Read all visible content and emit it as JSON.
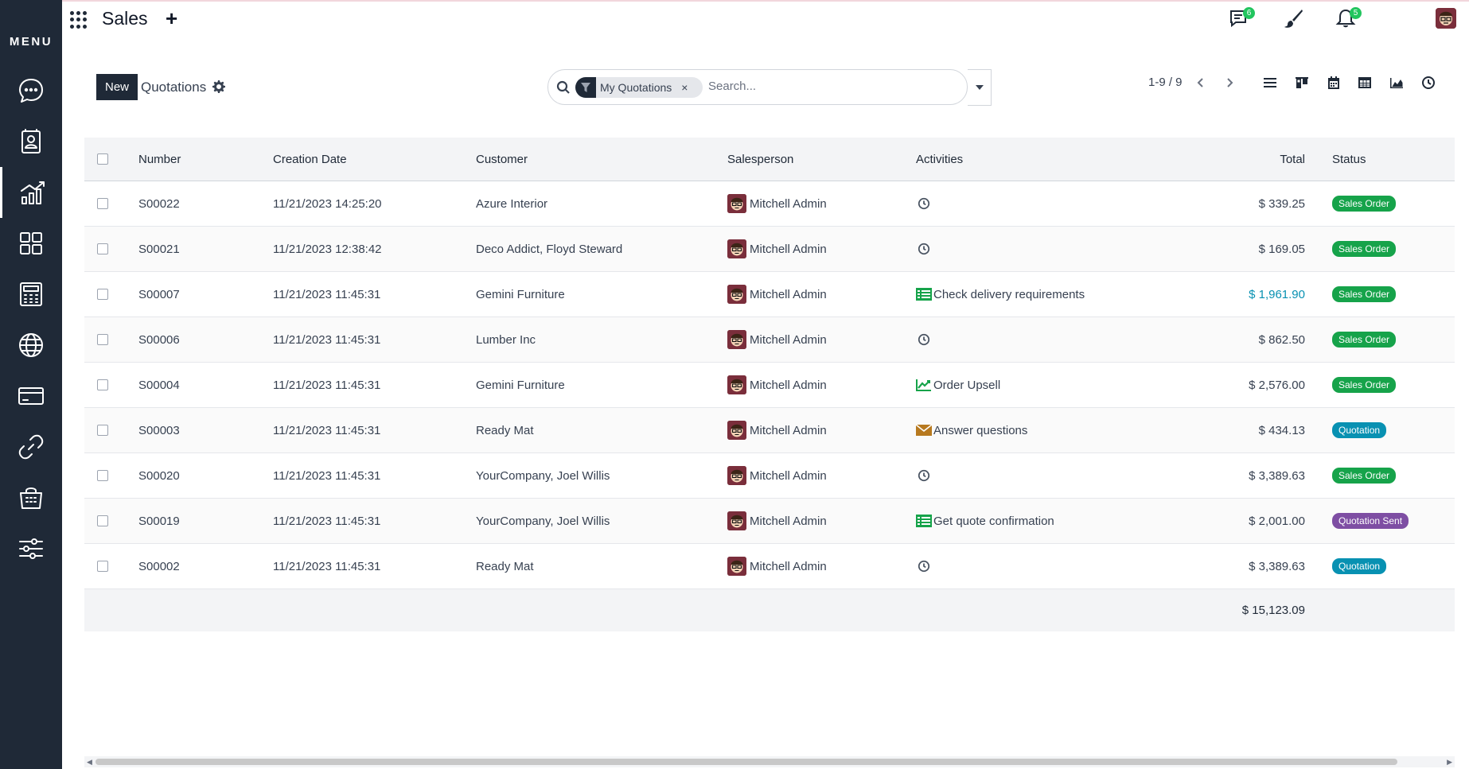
{
  "sidebar": {
    "menu_label": "MENU",
    "items": [
      {
        "icon": "discuss-icon"
      },
      {
        "icon": "contacts-icon"
      },
      {
        "icon": "sales-chart-icon",
        "active": true
      },
      {
        "icon": "dashboard-icon"
      },
      {
        "icon": "calculator-icon"
      },
      {
        "icon": "website-globe-icon"
      },
      {
        "icon": "card-icon"
      },
      {
        "icon": "link-icon"
      },
      {
        "icon": "shop-basket-icon"
      },
      {
        "icon": "settings-sliders-icon"
      }
    ]
  },
  "header": {
    "app_title": "Sales",
    "plus_label": "+",
    "messages_count": "6",
    "notifications_count": "5"
  },
  "control_panel": {
    "new_label": "New",
    "breadcrumb": "Quotations",
    "search": {
      "facet_label": "My Quotations",
      "facet_remove": "×",
      "placeholder": "Search..."
    },
    "pager": "1-9 / 9",
    "views": [
      "list-view-icon",
      "kanban-view-icon",
      "calendar-view-icon",
      "pivot-view-icon",
      "graph-view-icon",
      "activity-view-icon"
    ]
  },
  "table": {
    "headers": {
      "number": "Number",
      "creation_date": "Creation Date",
      "customer": "Customer",
      "salesperson": "Salesperson",
      "activities": "Activities",
      "total": "Total",
      "status": "Status"
    },
    "rows": [
      {
        "number": "S00022",
        "date": "11/21/2023 14:25:20",
        "customer": "Azure Interior",
        "salesperson": "Mitchell Admin",
        "activity": "",
        "activity_icon": "clock-icon",
        "total": "$ 339.25",
        "status": "Sales Order",
        "status_color": "#16a34a"
      },
      {
        "number": "S00021",
        "date": "11/21/2023 12:38:42",
        "customer": "Deco Addict, Floyd Steward",
        "salesperson": "Mitchell Admin",
        "activity": "",
        "activity_icon": "clock-icon",
        "total": "$ 169.05",
        "status": "Sales Order",
        "status_color": "#16a34a"
      },
      {
        "number": "S00007",
        "date": "11/21/2023 11:45:31",
        "customer": "Gemini Furniture",
        "salesperson": "Mitchell Admin",
        "activity": "Check delivery requirements",
        "activity_icon": "todo-list-icon",
        "total": "$ 1,961.90",
        "total_highlight": true,
        "status": "Sales Order",
        "status_color": "#16a34a"
      },
      {
        "number": "S00006",
        "date": "11/21/2023 11:45:31",
        "customer": "Lumber Inc",
        "salesperson": "Mitchell Admin",
        "activity": "",
        "activity_icon": "clock-icon",
        "total": "$ 862.50",
        "status": "Sales Order",
        "status_color": "#16a34a"
      },
      {
        "number": "S00004",
        "date": "11/21/2023 11:45:31",
        "customer": "Gemini Furniture",
        "salesperson": "Mitchell Admin",
        "activity": "Order Upsell",
        "activity_icon": "upsell-chart-icon",
        "total": "$ 2,576.00",
        "status": "Sales Order",
        "status_color": "#16a34a"
      },
      {
        "number": "S00003",
        "date": "11/21/2023 11:45:31",
        "customer": "Ready Mat",
        "salesperson": "Mitchell Admin",
        "activity": "Answer questions",
        "activity_icon": "envelope-icon",
        "total": "$ 434.13",
        "status": "Quotation",
        "status_color": "#0891b2"
      },
      {
        "number": "S00020",
        "date": "11/21/2023 11:45:31",
        "customer": "YourCompany, Joel Willis",
        "salesperson": "Mitchell Admin",
        "activity": "",
        "activity_icon": "clock-icon",
        "total": "$ 3,389.63",
        "status": "Sales Order",
        "status_color": "#16a34a"
      },
      {
        "number": "S00019",
        "date": "11/21/2023 11:45:31",
        "customer": "YourCompany, Joel Willis",
        "salesperson": "Mitchell Admin",
        "activity": "Get quote confirmation",
        "activity_icon": "todo-list-icon",
        "total": "$ 2,001.00",
        "status": "Quotation Sent",
        "status_color": "#7e4ea3"
      },
      {
        "number": "S00002",
        "date": "11/21/2023 11:45:31",
        "customer": "Ready Mat",
        "salesperson": "Mitchell Admin",
        "activity": "",
        "activity_icon": "clock-icon",
        "total": "$ 3,389.63",
        "status": "Quotation",
        "status_color": "#0891b2"
      }
    ],
    "sum_total": "$ 15,123.09"
  }
}
